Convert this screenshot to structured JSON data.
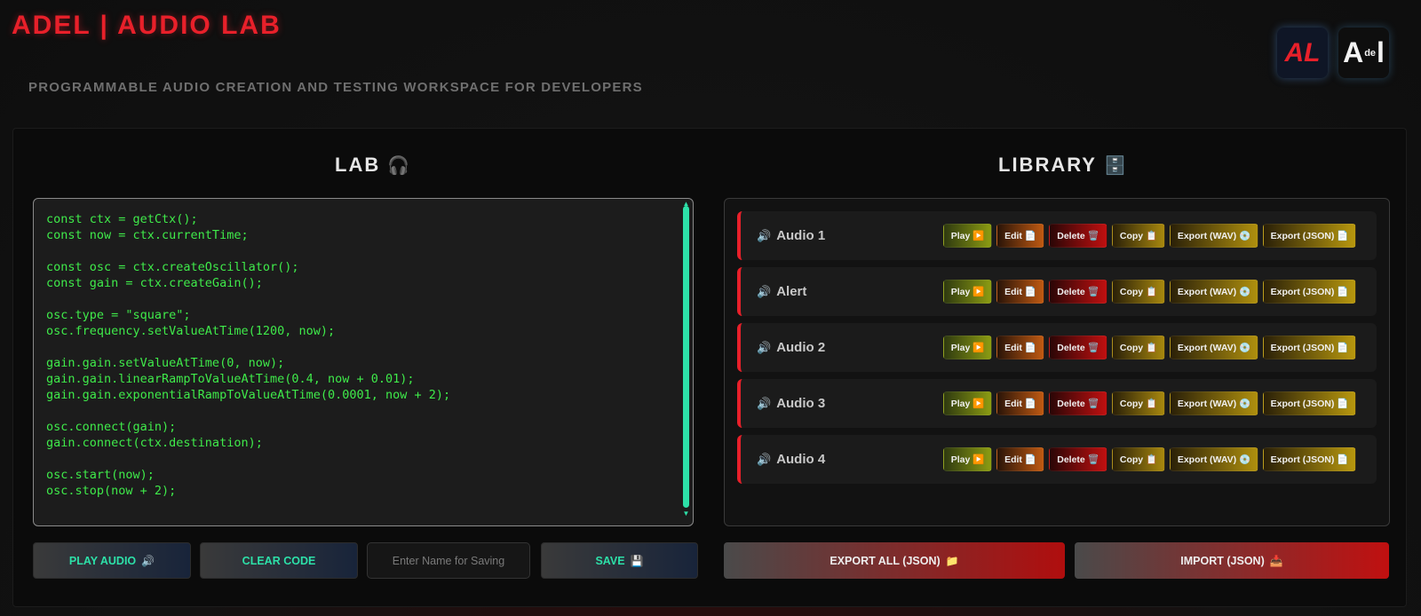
{
  "header": {
    "title": "ADEL | AUDIO LAB",
    "subtitle": "PROGRAMMABLE AUDIO CREATION AND TESTING WORKSPACE FOR DEVELOPERS",
    "logo_left": "AL",
    "logo_right_a": "A",
    "logo_right_de": "de",
    "logo_right_l": "l"
  },
  "lab": {
    "title": "LAB",
    "title_icon": "🎧",
    "code": "const ctx = getCtx();\nconst now = ctx.currentTime;\n\nconst osc = ctx.createOscillator();\nconst gain = ctx.createGain();\n\nosc.type = \"square\";\nosc.frequency.setValueAtTime(1200, now);\n\ngain.gain.setValueAtTime(0, now);\ngain.gain.linearRampToValueAtTime(0.4, now + 0.01);\ngain.gain.exponentialRampToValueAtTime(0.0001, now + 2);\n\nosc.connect(gain);\ngain.connect(ctx.destination);\n\nosc.start(now);\nosc.stop(now + 2);",
    "play_label": "PLAY AUDIO",
    "play_icon": "🔊",
    "clear_label": "CLEAR CODE",
    "name_placeholder": "Enter Name for Saving",
    "save_label": "SAVE",
    "save_icon": "💾"
  },
  "library": {
    "title": "LIBRARY",
    "title_icon": "🗄️",
    "speaker_icon": "🔊",
    "buttons": {
      "play": "Play ▶️",
      "edit": "Edit 📄",
      "delete": "Delete 🗑️",
      "copy": "Copy 📋",
      "export_wav": "Export (WAV) 💿",
      "export_json": "Export (JSON) 📄"
    },
    "items": [
      {
        "name": "Audio 1"
      },
      {
        "name": "Alert"
      },
      {
        "name": "Audio 2"
      },
      {
        "name": "Audio 3"
      },
      {
        "name": "Audio 4"
      }
    ],
    "export_all_label": "EXPORT ALL (JSON)",
    "export_all_icon": "📁",
    "import_label": "IMPORT (JSON)",
    "import_icon": "📥"
  },
  "colors": {
    "brand_red": "#e8202a",
    "code_green": "#3fea4a",
    "accent_teal": "#2de0a8"
  }
}
